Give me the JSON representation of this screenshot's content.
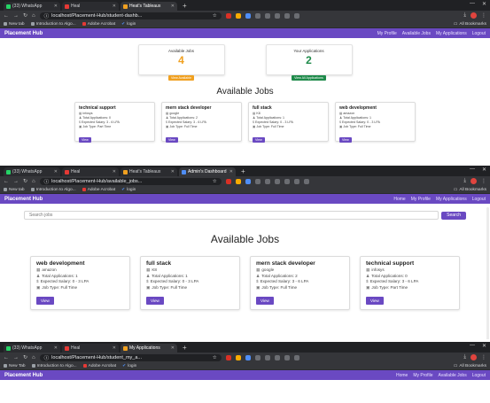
{
  "shot1": {
    "tabs": [
      {
        "label": "(33) WhatsApp",
        "color": "#25d366",
        "active": false
      },
      {
        "label": "Heal",
        "color": "#e53935",
        "active": false
      },
      {
        "label": "Heat's Tableaux",
        "color": "#f0a020",
        "active": true
      }
    ],
    "url": "localhost/Placement-Hub/student-dashb...",
    "bookmarks": [
      "New tab",
      "Introduction to Algo...",
      "Adobe Acrobat",
      "login"
    ],
    "all_bookmarks": "All Bookmarks",
    "brand": "Placement Hub",
    "nav": [
      "My Profile",
      "Available Jobs",
      "My Applications",
      "Logout"
    ],
    "stats": [
      {
        "label": "Available Jobs",
        "value": "4",
        "button": "View Available",
        "color": "orange"
      },
      {
        "label": "Your Applications",
        "value": "2",
        "button": "View All Applications",
        "color": "green"
      }
    ],
    "heading": "Available Jobs",
    "jobs": [
      {
        "title": "technical support",
        "company": "infosys",
        "apps": "Total Applications: 0",
        "salary": "Expected Salary: 3 - 6 LPA",
        "type": "Job Type: Part Time",
        "view": "View"
      },
      {
        "title": "mern stack developer",
        "company": "google",
        "apps": "Total Applications: 2",
        "salary": "Expected Salary: 3 - 6 LPA",
        "type": "Job Type: Full Time",
        "view": "View"
      },
      {
        "title": "full stack",
        "company": "K8",
        "apps": "Total Applications: 1",
        "salary": "Expected Salary: 0 - 3 LPA",
        "type": "Job Type: Full Time",
        "view": "View"
      },
      {
        "title": "web development",
        "company": "amazon",
        "apps": "Total Applications: 1",
        "salary": "Expected Salary: 0 - 3 LPA",
        "type": "Job Type: Full Time",
        "view": "View"
      }
    ]
  },
  "shot2": {
    "tabs": [
      {
        "label": "(33) WhatsApp",
        "color": "#25d366",
        "active": false
      },
      {
        "label": "Heal",
        "color": "#e53935",
        "active": false
      },
      {
        "label": "Heat's Tableaux",
        "color": "#f0a020",
        "active": false
      },
      {
        "label": "Admin's Dashboard",
        "color": "#4f8ef7",
        "active": true
      }
    ],
    "url": "localhost/Placement-Hub/available_jobs...",
    "bookmarks": [
      "New tab",
      "Introduction to Algo...",
      "Adobe Acrobat",
      "login"
    ],
    "all_bookmarks": "All Bookmarks",
    "brand": "Placement Hub",
    "nav": [
      "Home",
      "My Profile",
      "My Applications",
      "Logout"
    ],
    "search_placeholder": "Search jobs",
    "search_button": "Search",
    "heading": "Available Jobs",
    "jobs": [
      {
        "title": "web development",
        "company": "amazon",
        "apps": "Total Applications: 1",
        "salary": "Expected Salary: 0 - 3 LPA",
        "type": "Job Type: Full Time",
        "view": "View"
      },
      {
        "title": "full stack",
        "company": "K8",
        "apps": "Total Applications: 1",
        "salary": "Expected Salary: 0 - 3 LPA",
        "type": "Job Type: Full Time",
        "view": "View"
      },
      {
        "title": "mern stack developer",
        "company": "google",
        "apps": "Total Applications: 2",
        "salary": "Expected Salary: 3 - 6 LPA",
        "type": "Job Type: Full Time",
        "view": "View"
      },
      {
        "title": "technical support",
        "company": "infosys",
        "apps": "Total Applications: 0",
        "salary": "Expected Salary: 3 - 6 LPA",
        "type": "Job Type: Part Time",
        "view": "View"
      }
    ]
  },
  "shot3": {
    "tabs": [
      {
        "label": "(33) WhatsApp",
        "color": "#25d366",
        "active": false
      },
      {
        "label": "Heal",
        "color": "#e53935",
        "active": false
      },
      {
        "label": "My Applications",
        "color": "#f0a020",
        "active": true
      }
    ],
    "url": "localhost/Placement-Hub/student_my_a...",
    "bookmarks": [
      "New Tab",
      "Introduction to Algo...",
      "Adobe Acrobat",
      "login"
    ],
    "all_bookmarks": "All Bookmarks",
    "brand": "Placement Hub",
    "nav": [
      "Home",
      "My Profile",
      "Available Jobs",
      "Logout"
    ]
  }
}
